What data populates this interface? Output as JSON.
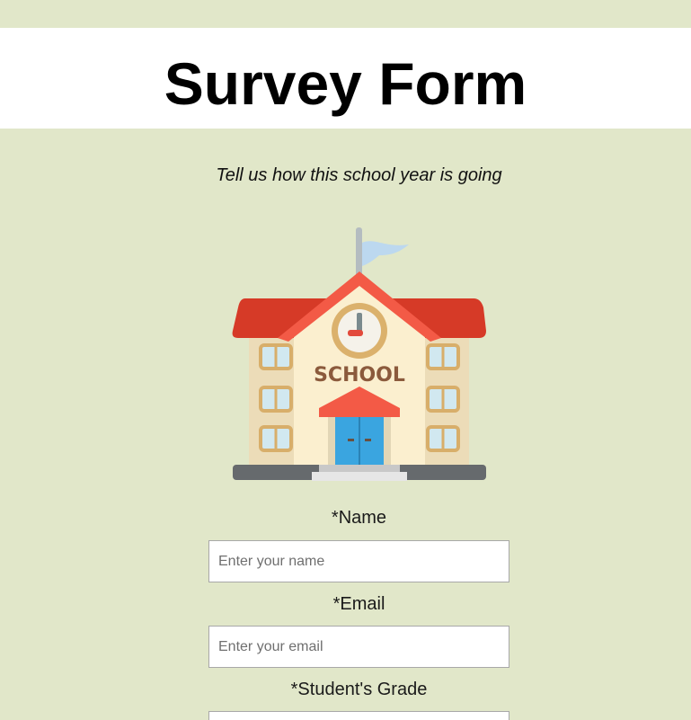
{
  "page": {
    "title": "Survey Form",
    "tagline": "Tell us how this school year is going"
  },
  "illustration": {
    "label": "SCHOOL",
    "icon": "school-building-icon"
  },
  "form": {
    "name": {
      "label": "*Name",
      "placeholder": "Enter your name",
      "value": ""
    },
    "email": {
      "label": "*Email",
      "placeholder": "Enter your email",
      "value": ""
    },
    "grade": {
      "label": "*Student's Grade"
    }
  },
  "colors": {
    "background": "#e1e7c9",
    "header_bg": "#ffffff",
    "roof": "#d63a27",
    "flag": "#bcd8ef",
    "door": "#3aa5e0",
    "wall": "#fbefcf"
  }
}
